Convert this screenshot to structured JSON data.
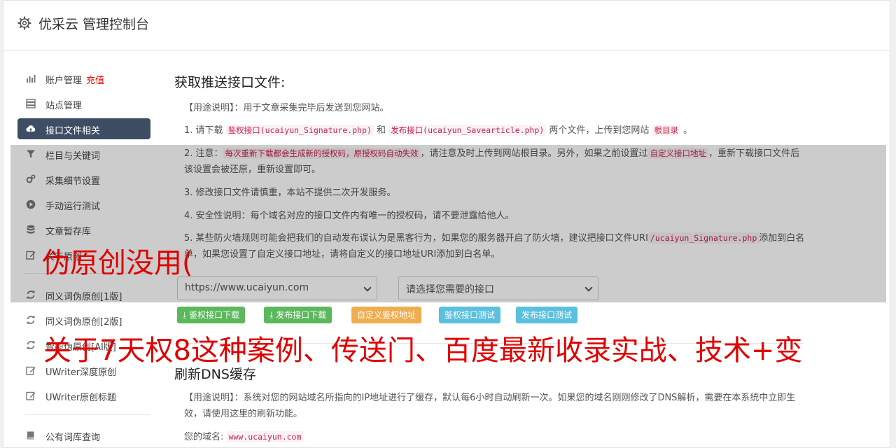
{
  "app": {
    "title": "优采云 管理控制台"
  },
  "sidebar": {
    "items": [
      {
        "label": "账户管理",
        "extra": "充值",
        "icon": "bar-chart-icon"
      },
      {
        "label": "站点管理",
        "icon": "server-icon"
      },
      {
        "label": "接口文件相关",
        "icon": "cloud-upload-icon",
        "active": true
      },
      {
        "label": "栏目与关键词",
        "icon": "filter-icon"
      },
      {
        "label": "采集细节设置",
        "icon": "cogs-icon"
      },
      {
        "label": "手动运行测试",
        "icon": "play-circle-icon"
      },
      {
        "label": "文章暂存库",
        "icon": "database-icon"
      },
      {
        "label": "关于原创",
        "icon": "edit-icon"
      },
      {
        "label": "同义词伪原创[1版]",
        "icon": "refresh-icon"
      },
      {
        "label": "同义词伪原创[2版]",
        "icon": "refresh-icon"
      },
      {
        "label": "智能伪原创[AI版]",
        "icon": "refresh-icon"
      },
      {
        "label": "UWriter深度原创",
        "icon": "edit-icon"
      },
      {
        "label": "UWriter原创标题",
        "icon": "edit-icon"
      },
      {
        "label": "公有词库查询",
        "icon": "book-icon"
      }
    ]
  },
  "section1": {
    "title": "获取推送接口文件:",
    "usage": "【用途说明】：用于文章采集完毕后发送到您网站。",
    "l1": {
      "a": "1. 请下载 ",
      "c1": "鉴权接口(ucaiyun_Signature.php)",
      "b": " 和 ",
      "c2": "发布接口(ucaiyun_Savearticle.php)",
      "c": " 两个文件，上传到您网站 ",
      "c3": "根目录",
      "d": " 。"
    },
    "l2": {
      "a": "2. 注意：",
      "c1": "每次重新下载都会生成新的授权码，原授权码自动失效",
      "b": "，请注意及时上传到网站根目录。另外，如果之前设置过",
      "c2": "自定义接口地址",
      "c": "，重新下载接口文件后该设置会被还原，重新设置即可。"
    },
    "l3": "3. 修改接口文件请慎重，本站不提供二次开发服务。",
    "l4": "4. 安全性说明：每个域名对应的接口文件内有唯一的授权码，请不要泄露给他人。",
    "l5": {
      "a": "5. 某些防火墙规则可能会把我们的自动发布误认为是黑客行为，如果您的服务器开启了防火墙，建议把接口文件URI",
      "c1": "/ucaiyun_Signature.php",
      "b": "添加到白名单，如果您设置了自定义接口地址，请将自定义的接口地址URI添加到白名单。"
    },
    "site_select": "https://www.ucaiyun.com",
    "iface_select": "请选择您需要的接口",
    "buttons": {
      "dl_auth": "鉴权接口下载",
      "dl_pub": "发布接口下载",
      "custom_auth": "自定义鉴权地址",
      "test_auth": "鉴权接口测试",
      "test_pub": "发布接口测试"
    }
  },
  "section2": {
    "title": "刷新DNS缓存",
    "usage": "【用途说明】：系统对您的网站域名所指向的IP地址进行了缓存，默认每6小时自动刷新一次。如果您的域名刚刚修改了DNS解析，需要在本系统中立即生效，请使用这里的刷新功能。",
    "domain_label": "您的域名:",
    "domain_value": "www.ucaiyun.com"
  },
  "captions": {
    "line1": "伪原创没用(",
    "line2": "关于7天权8这种案例、传送门、百度最新收录实战、技术+变"
  }
}
